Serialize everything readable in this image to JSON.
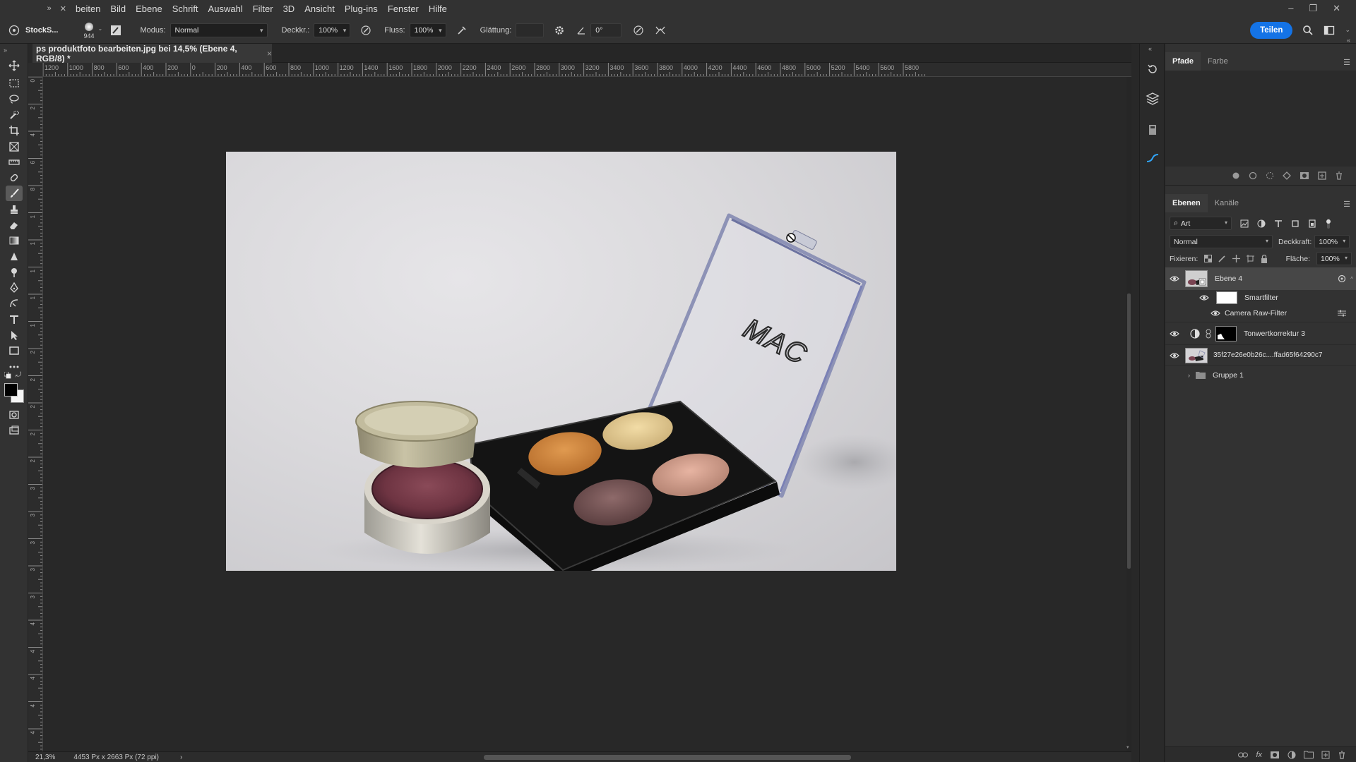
{
  "menubar": {
    "items": [
      "beiten",
      "Bild",
      "Ebene",
      "Schrift",
      "Auswahl",
      "Filter",
      "3D",
      "Ansicht",
      "Plug-ins",
      "Fenster",
      "Hilfe"
    ]
  },
  "options": {
    "workspace_label": "StockS...",
    "brush_size": "944",
    "mode_label": "Modus:",
    "mode_value": "Normal",
    "opacity_label": "Deckkr.:",
    "opacity_value": "100%",
    "flow_label": "Fluss:",
    "flow_value": "100%",
    "smoothing_label": "Glättung:",
    "smoothing_value": "",
    "angle_value": "0°",
    "share_label": "Teilen"
  },
  "document": {
    "tab_title": "ps produktfoto bearbeiten.jpg bei 14,5% (Ebene 4, RGB/8) *",
    "tab_close": "×"
  },
  "ruler": {
    "top_labels": [
      "1200",
      "1000",
      "800",
      "600",
      "400",
      "200",
      "0",
      "200",
      "400",
      "600",
      "800",
      "1000",
      "1200",
      "1400",
      "1600",
      "1800",
      "2000",
      "2200",
      "2400",
      "2600",
      "2800",
      "3000",
      "3200",
      "3400",
      "3600",
      "3800",
      "4000",
      "4200",
      "4400",
      "4600",
      "4800",
      "5000",
      "5200",
      "5400",
      "5600",
      "5800"
    ],
    "left_labels": [
      "0",
      "2",
      "4",
      "6",
      "8",
      "1",
      "1",
      "1",
      "1",
      "1",
      "2",
      "2",
      "2",
      "2",
      "2",
      "3",
      "3",
      "3",
      "3",
      "3",
      "4",
      "4",
      "4",
      "4",
      "4"
    ]
  },
  "status": {
    "zoom": "21,3%",
    "doc_size": "4453 Px x 2663 Px (72 ppi)",
    "arrow": "›"
  },
  "panels": {
    "top_tabs": [
      "Pfade",
      "Farbe"
    ],
    "layers_tabs": [
      "Ebenen",
      "Kanäle"
    ],
    "filter_kind": "Art",
    "blend_mode": "Normal",
    "opacity_label": "Deckkraft:",
    "opacity_value": "100%",
    "lock_label": "Fixieren:",
    "fill_label": "Fläche:",
    "fill_value": "100%"
  },
  "layers": [
    {
      "name": "Ebene 4",
      "visible": true,
      "selected": true
    },
    {
      "name": "Smartfilter",
      "visible": true
    },
    {
      "name": "Camera Raw-Filter",
      "visible": true
    },
    {
      "name": "Tonwertkorrektur 3",
      "visible": true
    },
    {
      "name": "35f27e26e0b26c....ffad65f64290c7",
      "visible": true
    },
    {
      "name": "Gruppe 1",
      "visible": false
    }
  ],
  "photo": {
    "brand_text": "MAC"
  },
  "colors": {
    "accent": "#1473e6",
    "panel_bg": "#323232",
    "canvas_bg": "#282828"
  }
}
